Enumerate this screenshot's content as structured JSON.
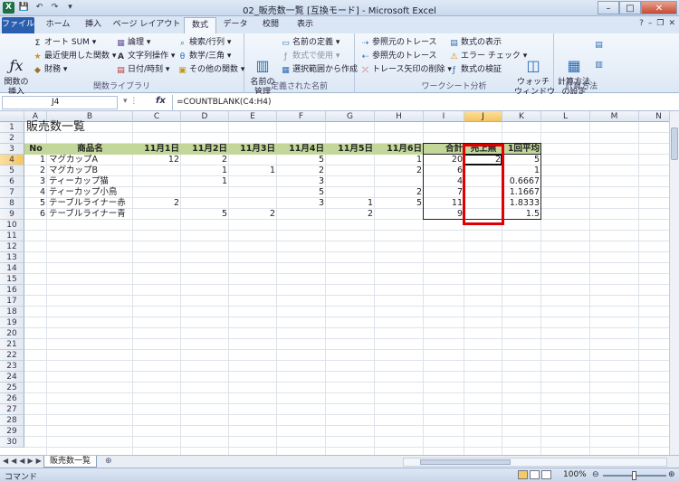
{
  "window": {
    "title": "02_販売数一覧 [互換モード] - Microsoft Excel"
  },
  "qat": {
    "logo": "X",
    "save": "💾",
    "undo": "↶",
    "redo": "↷",
    "more": "▾"
  },
  "winbtns": {
    "min": "–",
    "max": "□",
    "close": "✕"
  },
  "tabs": {
    "file": "ファイル",
    "home": "ホーム",
    "insert": "挿入",
    "layout": "ページ レイアウト",
    "formulas": "数式",
    "data": "データ",
    "review": "校閲",
    "view": "表示"
  },
  "tabicons": {
    "help": "?",
    "minimize": "–",
    "restore": "❐",
    "close": "✕"
  },
  "ribbon": {
    "insert_function": "関数の\n挿入",
    "autosum": "オート SUM",
    "recent": "最近使用した関数",
    "financial": "財務",
    "logical": "論理",
    "text": "文字列操作",
    "datetime": "日付/時刻",
    "lookup": "検索/行列",
    "math": "数学/三角",
    "more_funcs": "その他の関数",
    "group_library": "関数ライブラリ",
    "name_manager": "名前の\n管理",
    "define_name": "名前の定義",
    "use_in_formula": "数式で使用",
    "create_from_sel": "選択範囲から作成",
    "group_names": "定義された名前",
    "trace_precedents": "参照元のトレース",
    "trace_dependents": "参照先のトレース",
    "remove_arrows": "トレース矢印の削除",
    "show_formulas": "数式の表示",
    "error_check": "エラー チェック",
    "evaluate": "数式の検証",
    "watch": "ウォッチ\nウィンドウ",
    "group_audit": "ワークシート分析",
    "calc_options": "計算方法\nの設定",
    "group_calc": "計算方法"
  },
  "formula_bar": {
    "name_box": "J4",
    "fx": "fx",
    "buttons": "▾ ⋮",
    "formula": "=COUNTBLANK(C4:H4)"
  },
  "columns": [
    "A",
    "B",
    "C",
    "D",
    "E",
    "F",
    "G",
    "H",
    "I",
    "J",
    "K",
    "L",
    "M",
    "N"
  ],
  "rows": [
    "1",
    "2",
    "3",
    "4",
    "5",
    "6",
    "7",
    "8",
    "9",
    "10",
    "11",
    "12",
    "13",
    "14",
    "15",
    "16",
    "17",
    "18",
    "19",
    "20",
    "21",
    "22",
    "23",
    "24",
    "25",
    "26",
    "27",
    "28",
    "29",
    "30"
  ],
  "sheet": {
    "title": "販売数一覧",
    "headers": [
      "No",
      "商品名",
      "11月1日",
      "11月2日",
      "11月3日",
      "11月4日",
      "11月5日",
      "11月6日",
      "合計",
      "売上無",
      "1回平均"
    ],
    "data": [
      [
        "1",
        "マグカップA",
        "12",
        "2",
        "",
        "5",
        "",
        "1",
        "20",
        "2",
        "5"
      ],
      [
        "2",
        "マグカップB",
        "",
        "1",
        "1",
        "2",
        "",
        "2",
        "6",
        "",
        "1"
      ],
      [
        "3",
        "ティーカップ猫",
        "",
        "1",
        "",
        "3",
        "",
        "",
        "4",
        "",
        "0.6667"
      ],
      [
        "4",
        "ティーカップ小鳥",
        "",
        "",
        "",
        "5",
        "",
        "2",
        "7",
        "",
        "1.1667"
      ],
      [
        "5",
        "テーブルライナー赤",
        "2",
        "",
        "",
        "3",
        "1",
        "5",
        "11",
        "",
        "1.8333"
      ],
      [
        "6",
        "テーブルライナー青",
        "",
        "5",
        "2",
        "",
        "2",
        "",
        "9",
        "",
        "1.5"
      ]
    ]
  },
  "sheet_tabs": {
    "nav": "◀◀◀▶▶▶",
    "active": "販売数一覧",
    "new": "⊕"
  },
  "status": {
    "mode": "コマンド",
    "zoom": "100%",
    "minus": "⊖",
    "plus": "⊕"
  }
}
